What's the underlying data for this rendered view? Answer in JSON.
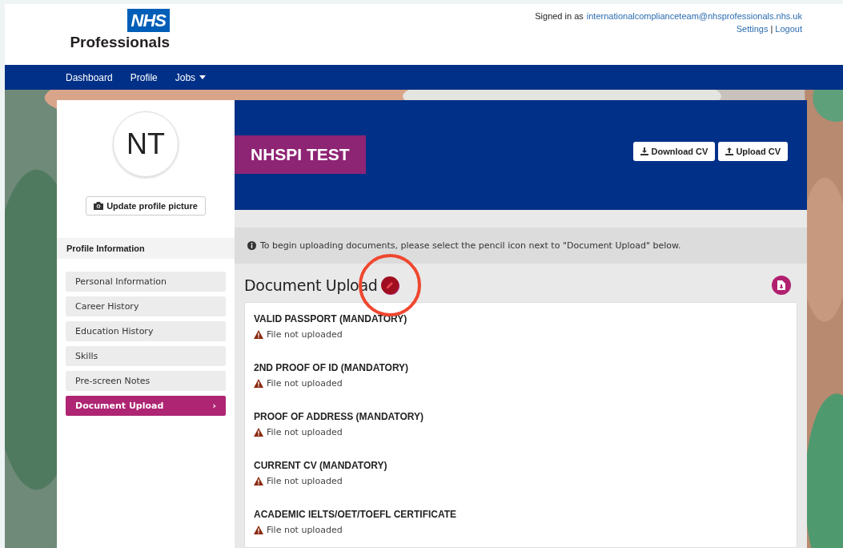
{
  "header": {
    "logo_badge": "NHS",
    "logo_text": "Professionals",
    "signed_in_label": "Signed in as",
    "signed_in_email": "internationalcomplianceteam@nhsprofessionals.nhs.uk",
    "links": [
      "Settings",
      "Logout"
    ],
    "link_separator": "|"
  },
  "nav": [
    {
      "label": "Dashboard",
      "dropdown": false
    },
    {
      "label": "Profile",
      "dropdown": false
    },
    {
      "label": "Jobs",
      "dropdown": true
    }
  ],
  "profile": {
    "initials": "NT",
    "update_picture_button": "Update profile picture",
    "name": "NHSPI TEST",
    "buttons": [
      {
        "label": "Download CV",
        "kind": "download"
      },
      {
        "label": "Upload CV",
        "kind": "upload"
      }
    ]
  },
  "sidebar": {
    "heading": "Profile Information",
    "items": [
      {
        "label": "Personal Information",
        "selected": false
      },
      {
        "label": "Career History",
        "selected": false
      },
      {
        "label": "Education History",
        "selected": false
      },
      {
        "label": "Skills",
        "selected": false
      },
      {
        "label": "Pre-screen Notes",
        "selected": false
      },
      {
        "label": "Document Upload",
        "selected": true,
        "chevron": "›"
      }
    ]
  },
  "info_message": "To begin uploading documents, please select the pencil icon next to \"Document Upload\" below.",
  "section": {
    "title": "Document Upload",
    "highlighted_edit": true,
    "documents": [
      {
        "name": "VALID PASSPORT (MANDATORY)",
        "status": "File not uploaded",
        "uploaded": false
      },
      {
        "name": "2ND PROOF OF ID (MANDATORY)",
        "status": "File not uploaded",
        "uploaded": false
      },
      {
        "name": "PROOF OF ADDRESS (MANDATORY)",
        "status": "File not uploaded",
        "uploaded": false
      },
      {
        "name": "CURRENT CV (MANDATORY)",
        "status": "File not uploaded",
        "uploaded": false
      },
      {
        "name": "ACADEMIC IELTS/OET/TOEFL CERTIFICATE",
        "status": "File not uploaded",
        "uploaded": false
      }
    ]
  }
}
